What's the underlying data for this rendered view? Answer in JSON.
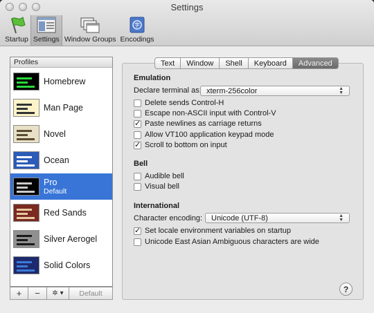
{
  "window": {
    "title": "Settings"
  },
  "toolbar": {
    "items": [
      {
        "label": "Startup",
        "icon": "startup-flag-icon"
      },
      {
        "label": "Settings",
        "icon": "settings-icon",
        "selected": true
      },
      {
        "label": "Window Groups",
        "icon": "window-groups-icon"
      },
      {
        "label": "Encodings",
        "icon": "encodings-icon"
      }
    ]
  },
  "sidebar": {
    "header": "Profiles",
    "profiles": [
      {
        "name": "Homebrew",
        "sub": "",
        "colors": [
          "#000000",
          "#28d93c"
        ]
      },
      {
        "name": "Man Page",
        "sub": "",
        "colors": [
          "#fcf4c8",
          "#333333"
        ]
      },
      {
        "name": "Novel",
        "sub": "",
        "colors": [
          "#e8e0c6",
          "#5a4a30"
        ]
      },
      {
        "name": "Ocean",
        "sub": "",
        "colors": [
          "#2c5bb8",
          "#ffffff"
        ]
      },
      {
        "name": "Pro",
        "sub": "Default",
        "colors": [
          "#000000",
          "#cccccc"
        ],
        "selected": true
      },
      {
        "name": "Red Sands",
        "sub": "",
        "colors": [
          "#7a2a20",
          "#e8c8a0"
        ]
      },
      {
        "name": "Silver Aerogel",
        "sub": "",
        "colors": [
          "#909090",
          "#1a1a1a"
        ]
      },
      {
        "name": "Solid Colors",
        "sub": "",
        "colors": [
          "#1e2a6e",
          "#3d7ad8"
        ]
      }
    ],
    "buttons": {
      "add": "+",
      "remove": "−",
      "action": "✲ ▾",
      "default": "Default"
    }
  },
  "tabs": [
    "Text",
    "Window",
    "Shell",
    "Keyboard",
    "Advanced"
  ],
  "selected_tab": "Advanced",
  "emulation": {
    "title": "Emulation",
    "declare_label": "Declare terminal as:",
    "declare_value": "xterm-256color",
    "options": [
      {
        "label": "Delete sends Control-H",
        "checked": false
      },
      {
        "label": "Escape non-ASCII input with Control-V",
        "checked": false
      },
      {
        "label": "Paste newlines as carriage returns",
        "checked": true
      },
      {
        "label": "Allow VT100 application keypad mode",
        "checked": false
      },
      {
        "label": "Scroll to bottom on input",
        "checked": true
      }
    ]
  },
  "bell": {
    "title": "Bell",
    "options": [
      {
        "label": "Audible bell",
        "checked": false
      },
      {
        "label": "Visual bell",
        "checked": false
      }
    ]
  },
  "international": {
    "title": "International",
    "encoding_label": "Character encoding:",
    "encoding_value": "Unicode (UTF-8)",
    "options": [
      {
        "label": "Set locale environment variables on startup",
        "checked": true
      },
      {
        "label": "Unicode East Asian Ambiguous characters are wide",
        "checked": false
      }
    ]
  },
  "help": {
    "label": "?"
  }
}
